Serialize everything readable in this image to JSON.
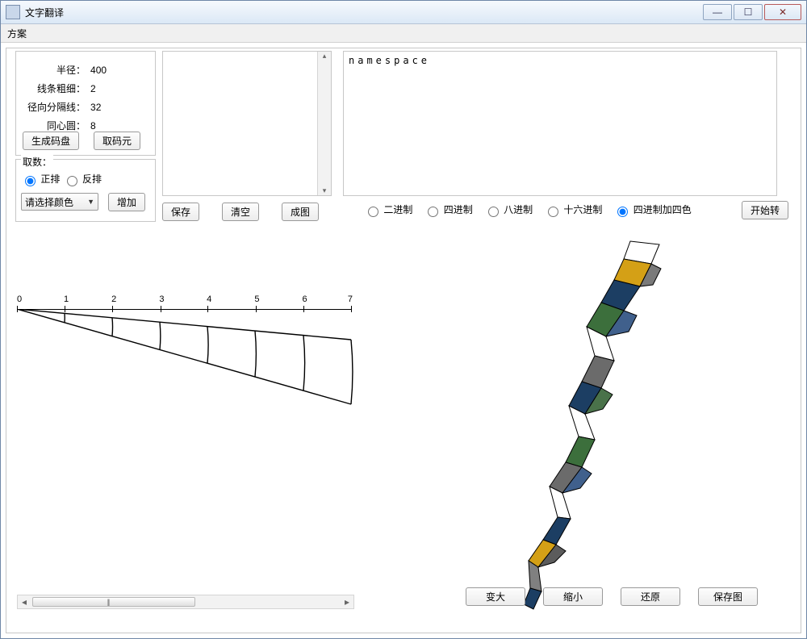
{
  "window": {
    "title": "文字翻译",
    "min_icon": "—",
    "max_icon": "☐",
    "close_icon": "✕"
  },
  "menu": {
    "item0": "方案"
  },
  "params": {
    "radius_label": "半径：",
    "radius_value": "400",
    "thick_label": "线条粗细：",
    "thick_value": "2",
    "radial_label": "径向分隔线：",
    "radial_value": "32",
    "ring_label": "同心圆：",
    "ring_value": "8",
    "gen_btn": "生成码盘",
    "pick_btn": "取码元"
  },
  "qushu": {
    "legend": "取数：",
    "fwd": "正排",
    "rev": "反排",
    "combo": "请选择颜色",
    "add": "增加"
  },
  "mid": {
    "save": "保存",
    "clear": "清空",
    "draw": "成图"
  },
  "ta_right_text": "namespace",
  "scroll": {
    "up": "▴",
    "down": "▾",
    "left": "◂",
    "right": "▸"
  },
  "coding": {
    "c2": "二进制",
    "c4": "四进制",
    "c8": "八进制",
    "c16": "十六进制",
    "c44": "四进制加四色"
  },
  "start": "开始转",
  "ruler": {
    "ticks": [
      0,
      1,
      2,
      3,
      4,
      5,
      6,
      7
    ]
  },
  "br": {
    "big": "变大",
    "small": "缩小",
    "restore": "还原",
    "saveimg": "保存图"
  }
}
